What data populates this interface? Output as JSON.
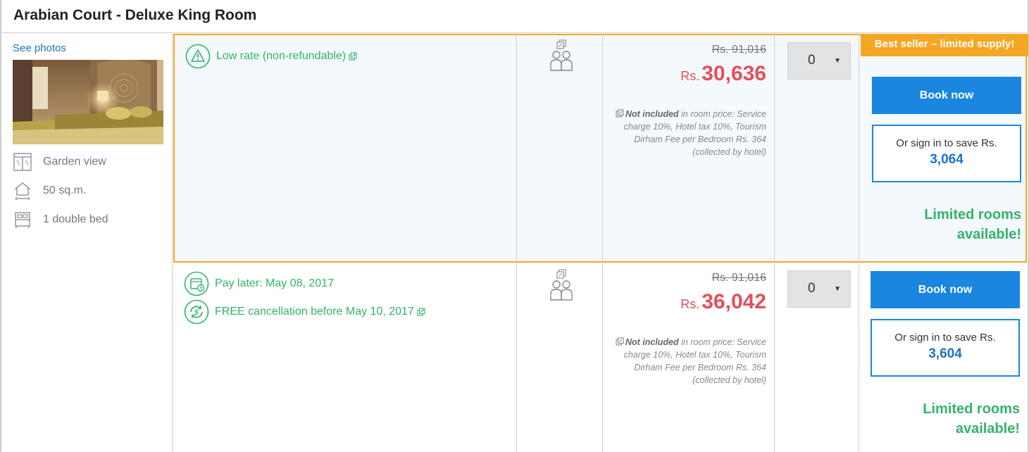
{
  "room": {
    "title": "Arabian Court - Deluxe King Room",
    "see_photos": "See photos",
    "features": [
      {
        "icon": "window-icon",
        "label": "Garden view"
      },
      {
        "icon": "house-size-icon",
        "label": "50 sq.m."
      },
      {
        "icon": "bed-icon",
        "label": "1 double bed"
      }
    ]
  },
  "rates": [
    {
      "conditions": [
        {
          "icon": "warning-icon",
          "label": "Low rate (non-refundable)"
        }
      ],
      "old_price": "Rs. 91,016",
      "currency": "Rs.",
      "price": "30,636",
      "not_included_label": "Not included",
      "not_included_text": " in room price: Service charge 10%, Hotel tax 10%, Tourism Dirham Fee per Bedroom Rs. 364 (collected by hotel)",
      "quantity": "0",
      "badge": "Best seller – limited supply!",
      "book_label": "Book now",
      "signin_text": "Or sign in to save Rs.",
      "signin_amount": "3,064",
      "limited_line1": "Limited rooms",
      "limited_line2": "available!"
    },
    {
      "conditions": [
        {
          "icon": "calendar-clock-icon",
          "label": "Pay later: May 08, 2017"
        },
        {
          "icon": "free-cancellation-icon",
          "label": "FREE cancellation before May 10, 2017"
        }
      ],
      "old_price": "Rs. 91,016",
      "currency": "Rs.",
      "price": "36,042",
      "not_included_label": "Not included",
      "not_included_text": " in room price: Service charge 10%, Hotel tax 10%, Tourism Dirham Fee per Bedroom Rs. 364 (collected by hotel)",
      "quantity": "0",
      "book_label": "Book now",
      "signin_text": "Or sign in to save Rs.",
      "signin_amount": "3,604",
      "limited_line1": "Limited rooms",
      "limited_line2": "available!"
    }
  ],
  "colors": {
    "accent_orange": "#f5a623",
    "primary_blue": "#1a86e0",
    "price_red": "#e4505a",
    "success_green": "#34b36a"
  }
}
